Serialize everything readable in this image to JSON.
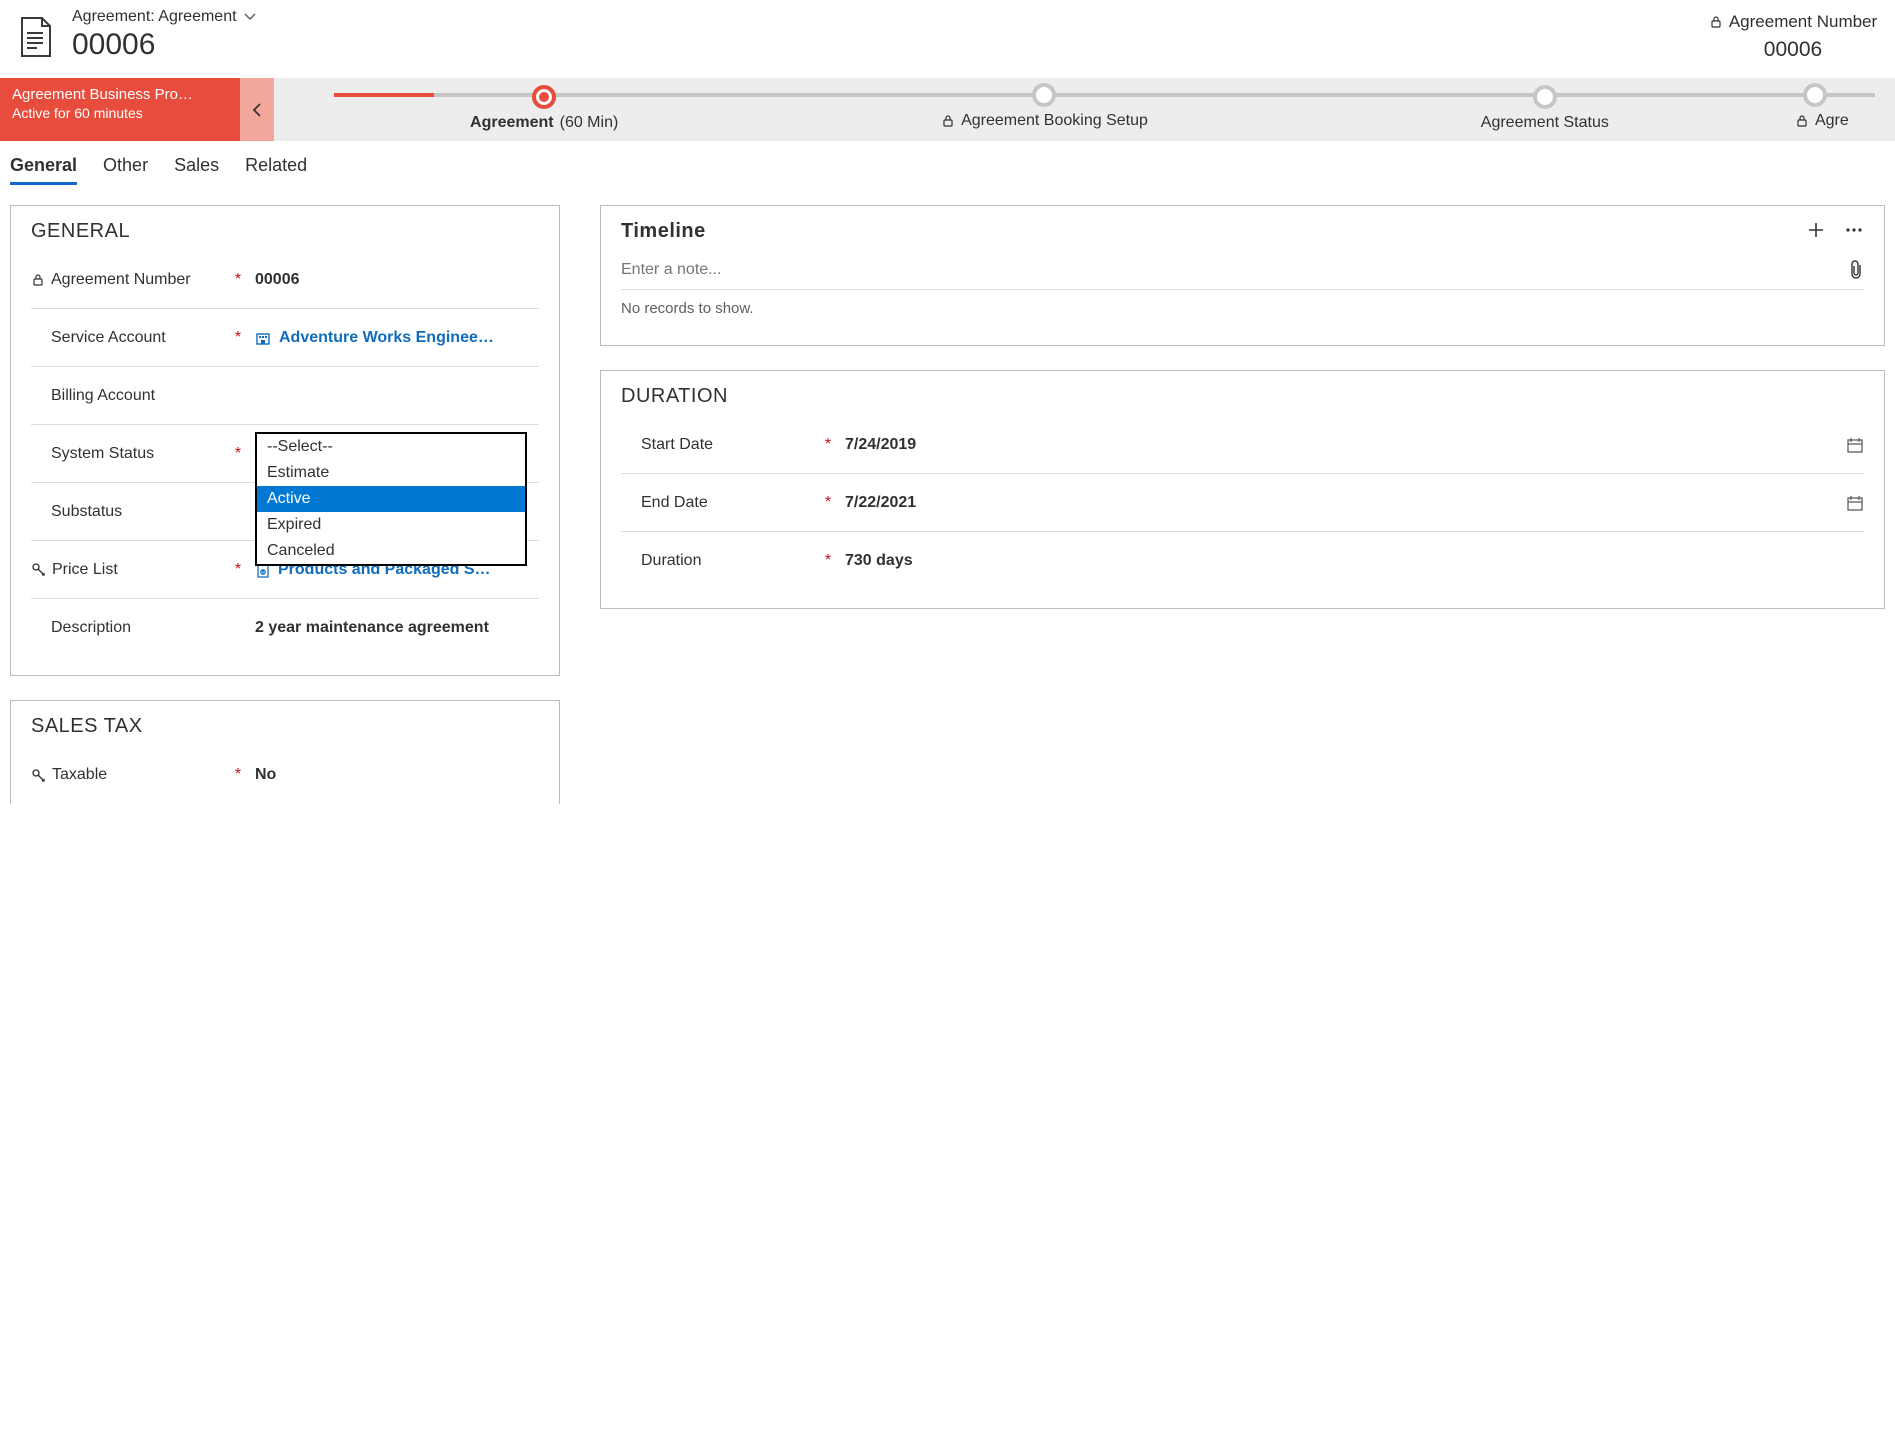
{
  "header": {
    "form_label": "Agreement: Agreement",
    "title": "00006",
    "key_label": "Agreement Number",
    "key_value": "00006"
  },
  "process": {
    "name": "Agreement Business Pro…",
    "status": "Active for 60 minutes",
    "stages": [
      {
        "label": "Agreement",
        "time": "(60 Min)",
        "active": true,
        "locked": false
      },
      {
        "label": "Agreement Booking Setup",
        "time": "",
        "active": false,
        "locked": true
      },
      {
        "label": "Agreement Status",
        "time": "",
        "active": false,
        "locked": false
      },
      {
        "label": "Agre",
        "time": "",
        "active": false,
        "locked": true
      }
    ]
  },
  "tabs": [
    "General",
    "Other",
    "Sales",
    "Related"
  ],
  "active_tab": "General",
  "general": {
    "title": "GENERAL",
    "agreement_number": {
      "label": "Agreement Number",
      "value": "00006"
    },
    "service_account": {
      "label": "Service Account",
      "value": "Adventure Works Enginee…"
    },
    "billing_account": {
      "label": "Billing Account",
      "value": ""
    },
    "system_status": {
      "label": "System Status",
      "value": "Active",
      "options": [
        "--Select--",
        "Estimate",
        "Active",
        "Expired",
        "Canceled"
      ]
    },
    "substatus": {
      "label": "Substatus",
      "value": ""
    },
    "price_list": {
      "label": "Price List",
      "value": "Products and Packaged S…"
    },
    "description": {
      "label": "Description",
      "value": "2 year maintenance agreement"
    }
  },
  "sales_tax": {
    "title": "SALES TAX",
    "taxable": {
      "label": "Taxable",
      "value": "No"
    }
  },
  "timeline": {
    "title": "Timeline",
    "placeholder": "Enter a note...",
    "empty": "No records to show."
  },
  "duration": {
    "title": "DURATION",
    "start_date": {
      "label": "Start Date",
      "value": "7/24/2019"
    },
    "end_date": {
      "label": "End Date",
      "value": "7/22/2021"
    },
    "duration": {
      "label": "Duration",
      "value": "730 days"
    }
  }
}
